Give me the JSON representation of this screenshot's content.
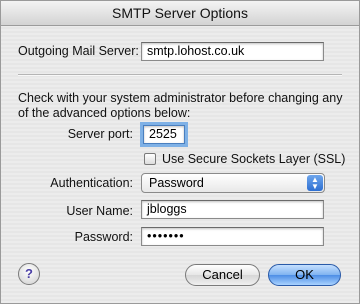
{
  "window": {
    "title": "SMTP Server Options"
  },
  "outgoing": {
    "label": "Outgoing Mail Server:",
    "value": "smtp.lohost.co.uk"
  },
  "info": {
    "text": "Check with your system administrator before changing any of the advanced options below:"
  },
  "port": {
    "label": "Server port:",
    "value": "2525"
  },
  "ssl": {
    "label": "Use Secure Sockets Layer (SSL)",
    "checked": false
  },
  "auth": {
    "label": "Authentication:",
    "selected": "Password"
  },
  "username": {
    "label": "User Name:",
    "value": "jbloggs"
  },
  "password": {
    "label": "Password:",
    "masked": "•••••••"
  },
  "buttons": {
    "help": "?",
    "cancel": "Cancel",
    "ok": "OK"
  },
  "colors": {
    "focus_ring": "#7fb1e6",
    "default_button": "#4d8ee6",
    "popup_arrows": "#2d6fd2"
  },
  "icons": {
    "help": "help-icon",
    "popup": "chevron-updown-icon"
  }
}
